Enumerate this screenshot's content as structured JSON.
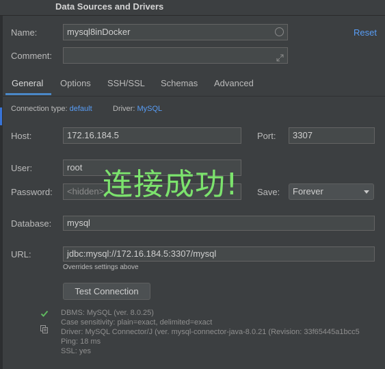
{
  "window": {
    "title": "Data Sources and Drivers"
  },
  "form": {
    "name_label": "Name:",
    "name_value": "mysql8inDocker",
    "reset_label": "Reset",
    "comment_label": "Comment:",
    "comment_value": ""
  },
  "tabs": [
    {
      "label": "General",
      "active": true
    },
    {
      "label": "Options",
      "active": false
    },
    {
      "label": "SSH/SSL",
      "active": false
    },
    {
      "label": "Schemas",
      "active": false
    },
    {
      "label": "Advanced",
      "active": false
    }
  ],
  "connection": {
    "type_label": "Connection type:",
    "type_value": "default",
    "driver_label": "Driver:",
    "driver_value": "MySQL"
  },
  "fields": {
    "host_label": "Host:",
    "host_value": "172.16.184.5",
    "port_label": "Port:",
    "port_value": "3307",
    "user_label": "User:",
    "user_value": "root",
    "password_label": "Password:",
    "password_placeholder": "<hidden>",
    "save_label": "Save:",
    "save_value": "Forever",
    "database_label": "Database:",
    "database_value": "mysql",
    "url_label": "URL:",
    "url_value": "jdbc:mysql://172.16.184.5:3307/mysql",
    "url_hint": "Overrides settings above"
  },
  "test_button_label": "Test Connection",
  "status": {
    "dbms": "DBMS: MySQL (ver. 8.0.25)",
    "case": "Case sensitivity: plain=exact, delimited=exact",
    "driver": "Driver: MySQL Connector/J (ver. mysql-connector-java-8.0.21 (Revision: 33f65445a1bcc5",
    "ping": "Ping: 18 ms",
    "ssl": "SSL: yes"
  },
  "overlay": {
    "text": "连接成功!"
  },
  "colors": {
    "accent": "#589df6",
    "success": "#5fb85f",
    "overlay_text": "#7ce36d"
  },
  "icons": [
    "status-circle-icon",
    "expand-icon",
    "check-icon",
    "copy-icon",
    "dropdown-arrow-icon"
  ]
}
